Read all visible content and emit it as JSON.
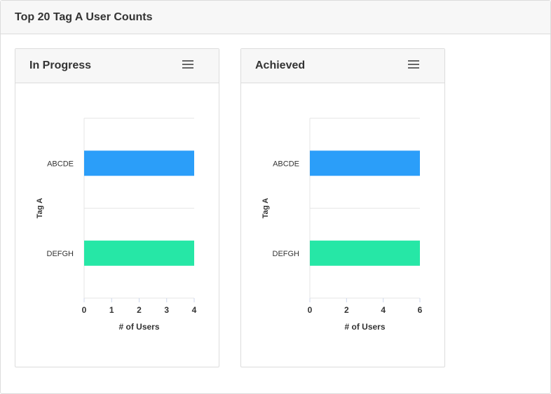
{
  "page": {
    "title": "Top 20 Tag A User Counts"
  },
  "panels": [
    {
      "title": "In Progress",
      "menu_icon": "hamburger-menu-icon"
    },
    {
      "title": "Achieved",
      "menu_icon": "hamburger-menu-icon"
    }
  ],
  "chart_data": [
    {
      "type": "bar",
      "orientation": "horizontal",
      "title": "In Progress",
      "categories": [
        "ABCDE",
        "DEFGH"
      ],
      "values": [
        4,
        4
      ],
      "bar_colors": [
        "#2b9ef9",
        "#26e7a6"
      ],
      "xlabel": "# of Users",
      "ylabel": "Tag A",
      "xlim": [
        0,
        4
      ],
      "xticks": [
        0,
        1,
        2,
        3,
        4
      ],
      "grid": true,
      "legend": "none"
    },
    {
      "type": "bar",
      "orientation": "horizontal",
      "title": "Achieved",
      "categories": [
        "ABCDE",
        "DEFGH"
      ],
      "values": [
        6,
        6
      ],
      "bar_colors": [
        "#2b9ef9",
        "#26e7a6"
      ],
      "xlabel": "# of Users",
      "ylabel": "Tag A",
      "xlim": [
        0,
        6
      ],
      "xticks": [
        0,
        2,
        4,
        6
      ],
      "grid": true,
      "legend": "none"
    }
  ]
}
